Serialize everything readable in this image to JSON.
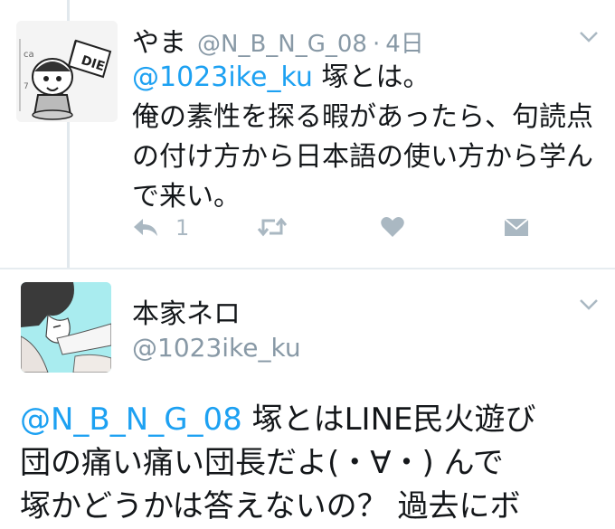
{
  "reply_tweet": {
    "display_name": "やま",
    "handle": "@N_B_N_G_08",
    "separator": "·",
    "time": "4日",
    "mention": "@1023ike_ku",
    "line1_rest": " 塚とは。",
    "line2": "俺の素性を探る暇があったら、句読点",
    "line3": "の付け方から日本語の使い方から学ん",
    "line4": "で来い。",
    "reply_count": "1",
    "avatar_flag_text": "DIE"
  },
  "main_tweet": {
    "display_name": "本家ネロ",
    "handle": "@1023ike_ku",
    "mention": "@N_B_N_G_08",
    "line1_rest": " 塚とはLINE民火遊び",
    "line2": "団の痛い痛い団長だよ(・∀・) んで",
    "line3": "塚かどうかは答えないの？ 過去にボ"
  },
  "icons": {
    "caret": "chevron-down-icon",
    "reply": "reply-icon",
    "retweet": "retweet-icon",
    "like": "heart-icon",
    "dm": "envelope-icon"
  },
  "colors": {
    "link": "#1da1f2",
    "secondary": "#8899a6",
    "action": "#aab8c2",
    "avatar2_bg": "#a9ecef"
  }
}
